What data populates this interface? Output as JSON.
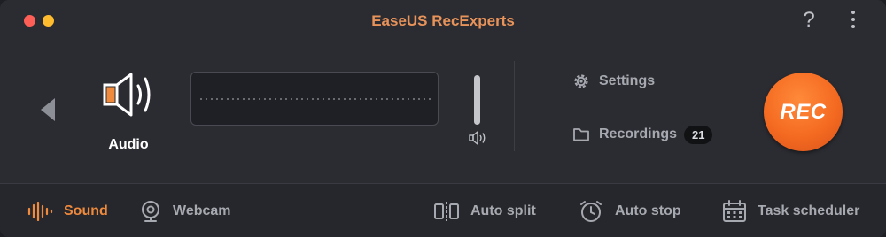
{
  "app": {
    "title": "EaseUS RecExperts"
  },
  "main": {
    "mode_label": "Audio",
    "settings_label": "Settings",
    "recordings_label": "Recordings",
    "recordings_count": "21",
    "rec_label": "REC"
  },
  "toolbar": {
    "sound_label": "Sound",
    "webcam_label": "Webcam",
    "autosplit_label": "Auto split",
    "autostop_label": "Auto stop",
    "scheduler_label": "Task scheduler"
  },
  "colors": {
    "accent": "#f08a3c",
    "title": "#e8935a",
    "rec_button": "#f46a21",
    "background": "#2b2c32"
  },
  "icons": {
    "help": "question-mark-icon",
    "more": "vertical-ellipsis-icon",
    "audio": "speaker-icon",
    "settings": "gear-icon",
    "recordings": "folder-icon"
  }
}
